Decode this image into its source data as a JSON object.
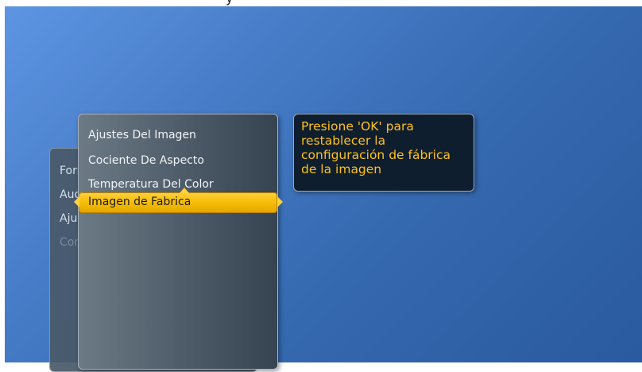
{
  "top_fragment": "y",
  "back_menu": {
    "items": [
      {
        "label": "Formato De Imagen"
      },
      {
        "label": "Aud"
      },
      {
        "label": "Aju"
      },
      {
        "label": "Consumo de Energía"
      }
    ]
  },
  "front_menu": {
    "items": [
      {
        "label": "Ajustes Del Imagen"
      },
      {
        "label": "Cociente De Aspecto"
      },
      {
        "label": "Temperatura Del Color"
      },
      {
        "label": "Imagen de Fabrica"
      }
    ],
    "selected_index": 3
  },
  "tooltip": {
    "text": "Presione 'OK' para restablecer la configuración de fábrica de la imagen"
  },
  "colors": {
    "accent": "#f3b800",
    "tooltip_text": "#ffc21a",
    "background": "#3569b0"
  }
}
